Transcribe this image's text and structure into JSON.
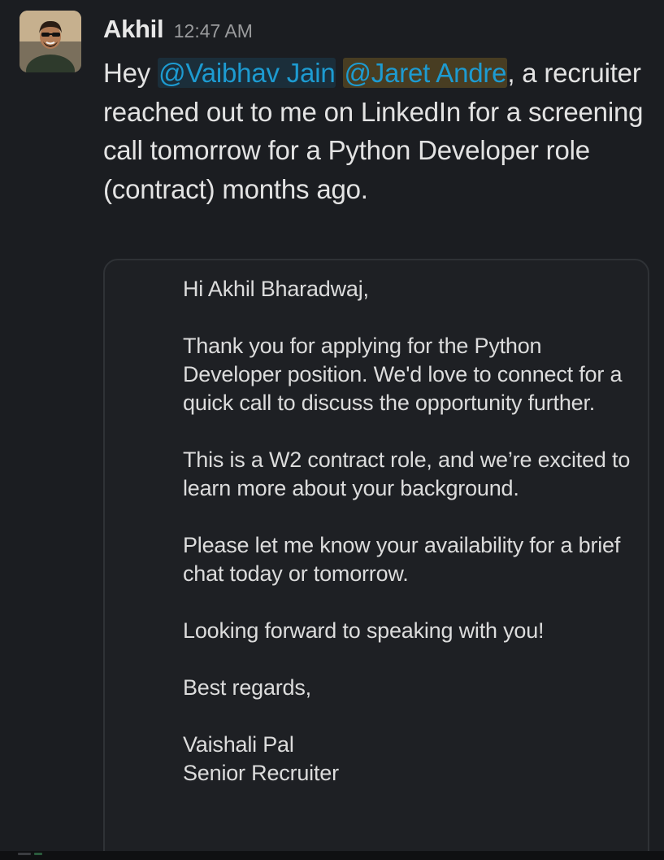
{
  "message": {
    "author": "Akhil",
    "timestamp": "12:47 AM",
    "text_prefix": "Hey ",
    "mention_1": "@Vaibhav Jain",
    "mention_2": "@Jaret Andre",
    "text_suffix": ", a recruiter reached out to me on LinkedIn for a screening call tomorrow for a Python Developer role (contract) months ago."
  },
  "attachment": {
    "greeting": "Hi Akhil Bharadwaj,",
    "paragraph_1": "Thank you for applying for the Python Developer position. We'd love to connect for a quick call to discuss the opportunity further.",
    "paragraph_2": "This is a W2 contract role, and we’re excited to learn more about your background.",
    "paragraph_3": "Please let me know your availability for a brief chat today or tomorrow.",
    "paragraph_4": "Looking forward to speaking with you!",
    "closing": "Best regards,",
    "signature_name": "Vaishali Pal",
    "signature_title": "Senior Recruiter"
  },
  "colors": {
    "background": "#1b1d21",
    "mention": "#1d9bd1",
    "mention_highlight": "#e8b028"
  },
  "icons": {
    "avatar": "user-avatar-photo"
  }
}
